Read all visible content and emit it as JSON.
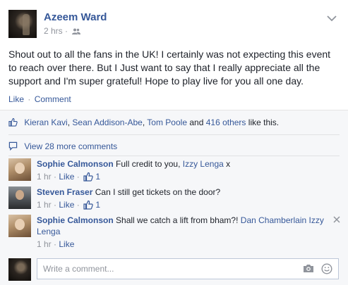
{
  "post": {
    "author": "Azeem Ward",
    "time": "2 hrs",
    "separator": "·",
    "text": "Shout out to all the fans in the UK! I certainly was not expecting this event to reach over there. But I Just want to say that I really appreciate all the support and I'm super grateful! Hope to play live for you all one day.",
    "actions": {
      "like": "Like",
      "dot": "·",
      "comment": "Comment"
    }
  },
  "likes": {
    "names": [
      "Kieran Kavi",
      "Sean Addison-Abe",
      "Tom Poole"
    ],
    "comma": ",",
    "and_text": "and",
    "others": "416 others",
    "suffix": "like this."
  },
  "more_comments": "View 28 more comments",
  "comments": [
    {
      "author": "Sophie Calmonson",
      "text": "Full credit to you,",
      "mention": "Izzy Lenga",
      "trailing": "x",
      "time": "1 hr",
      "like_label": "Like",
      "like_count": "1"
    },
    {
      "author": "Steven Fraser",
      "text": "Can I still get tickets on the door?",
      "time": "1 hr",
      "like_label": "Like",
      "like_count": "1"
    },
    {
      "author": "Sophie Calmonson",
      "text": "Shall we catch a lift from bham?!",
      "mention": "Dan Chamberlain Izzy Lenga",
      "time": "1 hr",
      "like_label": "Like"
    }
  ],
  "composer": {
    "placeholder": "Write a comment..."
  },
  "colors": {
    "link": "#365899",
    "muted": "#90949c",
    "feedback_bg": "#f6f7f9",
    "border": "#bdc7d8"
  }
}
